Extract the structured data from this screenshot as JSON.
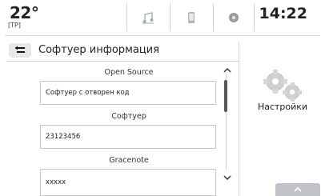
{
  "status": {
    "temperature": "22°",
    "traffic_program": "[TP]",
    "time": "14:22",
    "icons": [
      "music-note-icon",
      "phone-icon",
      "circle-icon"
    ]
  },
  "header": {
    "title": "Софтуер информация"
  },
  "main": {
    "sections": [
      {
        "label": "Open Source",
        "value": "Софтуер с отворен код"
      },
      {
        "label": "Софтуер",
        "value": "23123456"
      },
      {
        "label": "Gracenote",
        "value": "xxxxx"
      }
    ]
  },
  "sidebar": {
    "settings_label": "Настройки"
  },
  "colors": {
    "accent": "#bfc3c7",
    "text": "#222222",
    "border": "#c6c6c6"
  }
}
